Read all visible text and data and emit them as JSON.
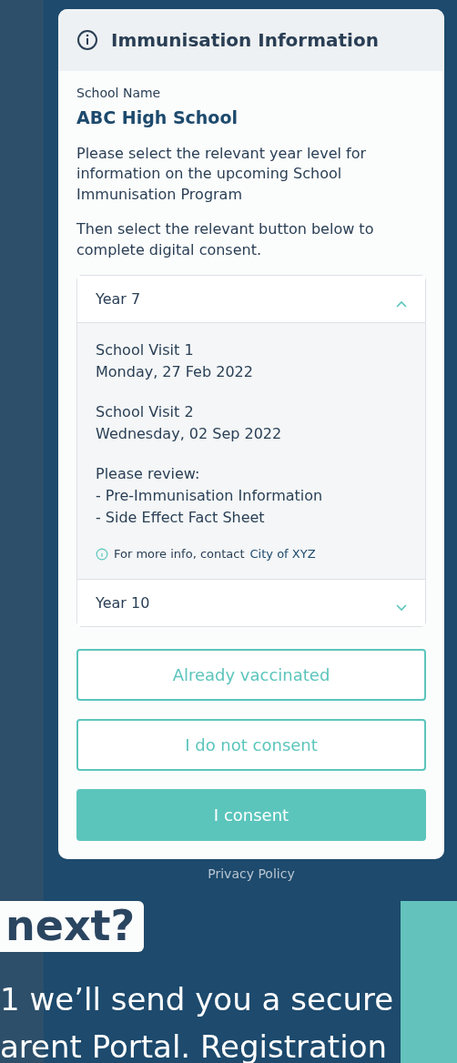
{
  "header": {
    "title": "Immunisation Information"
  },
  "school": {
    "label": "School Name",
    "value": "ABC High School"
  },
  "instructions": [
    "Please select the relevant year level for information on the upcoming School Immunisation Program",
    "Then select the relevant button below to complete digital consent."
  ],
  "years": [
    {
      "label": "Year 7",
      "expanded": true,
      "visits": [
        {
          "title": "School Visit 1",
          "date": "Monday, 27 Feb 2022"
        },
        {
          "title": "School Visit 2",
          "date": "Wednesday, 02 Sep 2022"
        }
      ],
      "review_heading": "Please review:",
      "review_items": [
        "- Pre-Immunisation Information",
        "- Side Effect Fact Sheet"
      ],
      "contact": {
        "text": "For more info, contact",
        "link": "City of XYZ"
      }
    },
    {
      "label": "Year 10",
      "expanded": false
    }
  ],
  "buttons": [
    {
      "label": "Already vaccinated",
      "kind": "outline"
    },
    {
      "label": "I do not consent",
      "kind": "outline"
    },
    {
      "label": "I consent",
      "kind": "filled"
    }
  ],
  "footer_link": "Privacy Policy",
  "page_overlay": {
    "heading": "next?",
    "lines": [
      "1 we’ll send you a secure",
      "arent Portal.  Registration"
    ]
  }
}
